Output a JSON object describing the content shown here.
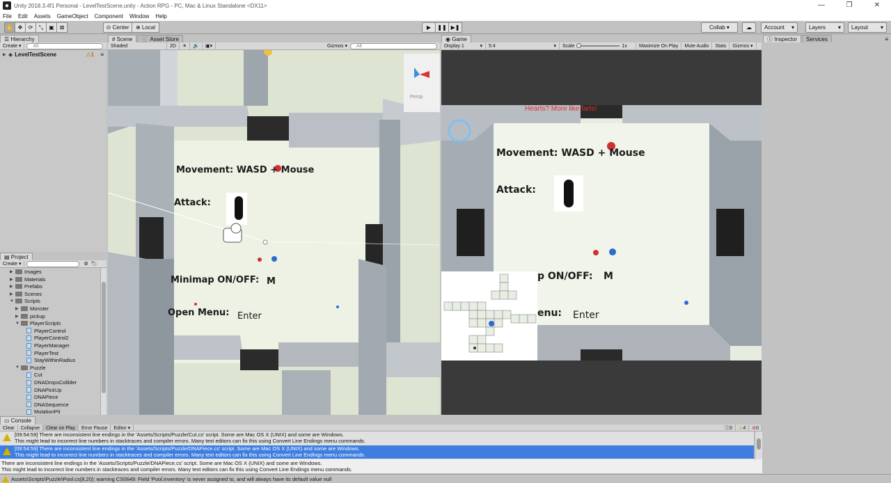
{
  "window": {
    "title": "Unity 2018.3.4f1 Personal - LevelTestScene.unity - Action RPG - PC, Mac & Linux Standalone <DX11>",
    "controls": [
      "—",
      "❐",
      "✕"
    ]
  },
  "menu": [
    "File",
    "Edit",
    "Assets",
    "GameObject",
    "Component",
    "Window",
    "Help"
  ],
  "toolbar": {
    "pivot": "Center",
    "space": "Local",
    "collab": "Collab ▾",
    "account": "Account",
    "layers": "Layers",
    "layout": "Layout"
  },
  "hierarchy": {
    "tab": "Hierarchy",
    "create": "Create ▾",
    "search_placeholder": "All",
    "scene": "LevelTestScene",
    "badge": "1"
  },
  "project": {
    "tab": "Project",
    "create": "Create ▾",
    "items": [
      {
        "label": "Images",
        "kind": "folder",
        "depth": 1
      },
      {
        "label": "Materials",
        "kind": "folder",
        "depth": 1
      },
      {
        "label": "Prefabs",
        "kind": "folder",
        "depth": 1
      },
      {
        "label": "Scenes",
        "kind": "folder",
        "depth": 1
      },
      {
        "label": "Scripts",
        "kind": "folder",
        "depth": 1
      },
      {
        "label": "Monster",
        "kind": "folder",
        "depth": 2
      },
      {
        "label": "pickup",
        "kind": "folder",
        "depth": 2
      },
      {
        "label": "PlayerScripts",
        "kind": "folder",
        "depth": 2
      },
      {
        "label": "PlayerControl",
        "kind": "script",
        "depth": 3
      },
      {
        "label": "PlayerControl2",
        "kind": "script",
        "depth": 3
      },
      {
        "label": "PlayerManager",
        "kind": "script",
        "depth": 3
      },
      {
        "label": "PlayerTest",
        "kind": "script",
        "depth": 3
      },
      {
        "label": "StayWithinRadius",
        "kind": "script",
        "depth": 3
      },
      {
        "label": "Puzzle",
        "kind": "folder",
        "depth": 2
      },
      {
        "label": "Cut",
        "kind": "script",
        "depth": 3
      },
      {
        "label": "DNADropsCollider",
        "kind": "script",
        "depth": 3
      },
      {
        "label": "DNAPickUp",
        "kind": "script",
        "depth": 3
      },
      {
        "label": "DNAPiece",
        "kind": "script",
        "depth": 3
      },
      {
        "label": "DNASequence",
        "kind": "script",
        "depth": 3
      },
      {
        "label": "MutationPit",
        "kind": "script",
        "depth": 3
      }
    ]
  },
  "scene": {
    "tab": "Scene",
    "asset_store_tab": "Asset Store",
    "shading": "Shaded",
    "mode_2d": "2D",
    "gizmos": "Gizmos ▾",
    "search_placeholder": "All",
    "persp": "Persp",
    "labels": {
      "movement": "Movement: WASD + Mouse",
      "attack": "Attack:",
      "minimap": "Minimap ON/OFF:",
      "minimap_key": "M",
      "open_menu": "Open Menu:",
      "open_menu_key": "Enter"
    }
  },
  "game": {
    "tab": "Game",
    "display": "Display 1",
    "aspect": "5:4",
    "scale_label": "Scale",
    "scale_value": "1x",
    "maximize": "Maximize On Play",
    "mute": "Mute Audio",
    "stats": "Stats",
    "gizmos": "Gizmos ▾",
    "hearts_text": "Hearts? More like farts!",
    "labels": {
      "movement": "Movement: WASD + Mouse",
      "attack": "Attack:",
      "minimap": "p ON/OFF:",
      "minimap_key": "M",
      "open_menu": "enu:",
      "open_menu_key": "Enter"
    }
  },
  "inspector": {
    "tab": "Inspector",
    "services_tab": "Services"
  },
  "console": {
    "tab": "Console",
    "buttons": [
      "Clear",
      "Collapse",
      "Clear on Play",
      "Error Pause",
      "Editor ▾"
    ],
    "counts": {
      "info": "0",
      "warn": "4",
      "error": "0"
    },
    "logs": [
      {
        "line1": "[09:54:59] There are inconsistent line endings in the 'Assets/Scripts/Puzzle/Cut.cs' script. Some are Mac OS X (UNIX) and some are Windows.",
        "line2": "This might lead to incorrect line numbers in stacktraces and compiler errors. Many text editors can fix this using Convert Line Endings menu commands."
      },
      {
        "line1": "[09:54:59] There are inconsistent line endings in the 'Assets/Scripts/Puzzle/DNAPiece.cs' script. Some are Mac OS X (UNIX) and some are Windows.",
        "line2": "This might lead to incorrect line numbers in stacktraces and compiler errors. Many text editors can fix this using Convert Line Endings menu commands."
      }
    ],
    "detail_line1": "There are inconsistent line endings in the 'Assets/Scripts/Puzzle/DNAPiece.cs' script. Some are Mac OS X (UNIX) and some are Windows.",
    "detail_line2": "This might lead to incorrect line numbers in stacktraces and compiler errors. Many text editors can fix this using Convert Line Endings menu commands."
  },
  "status": "Assets\\Scripts\\Puzzle\\Pool.cs(8,20): warning CS0649: Field 'Pool.inventory' is never assigned to, and will always have its default value null"
}
